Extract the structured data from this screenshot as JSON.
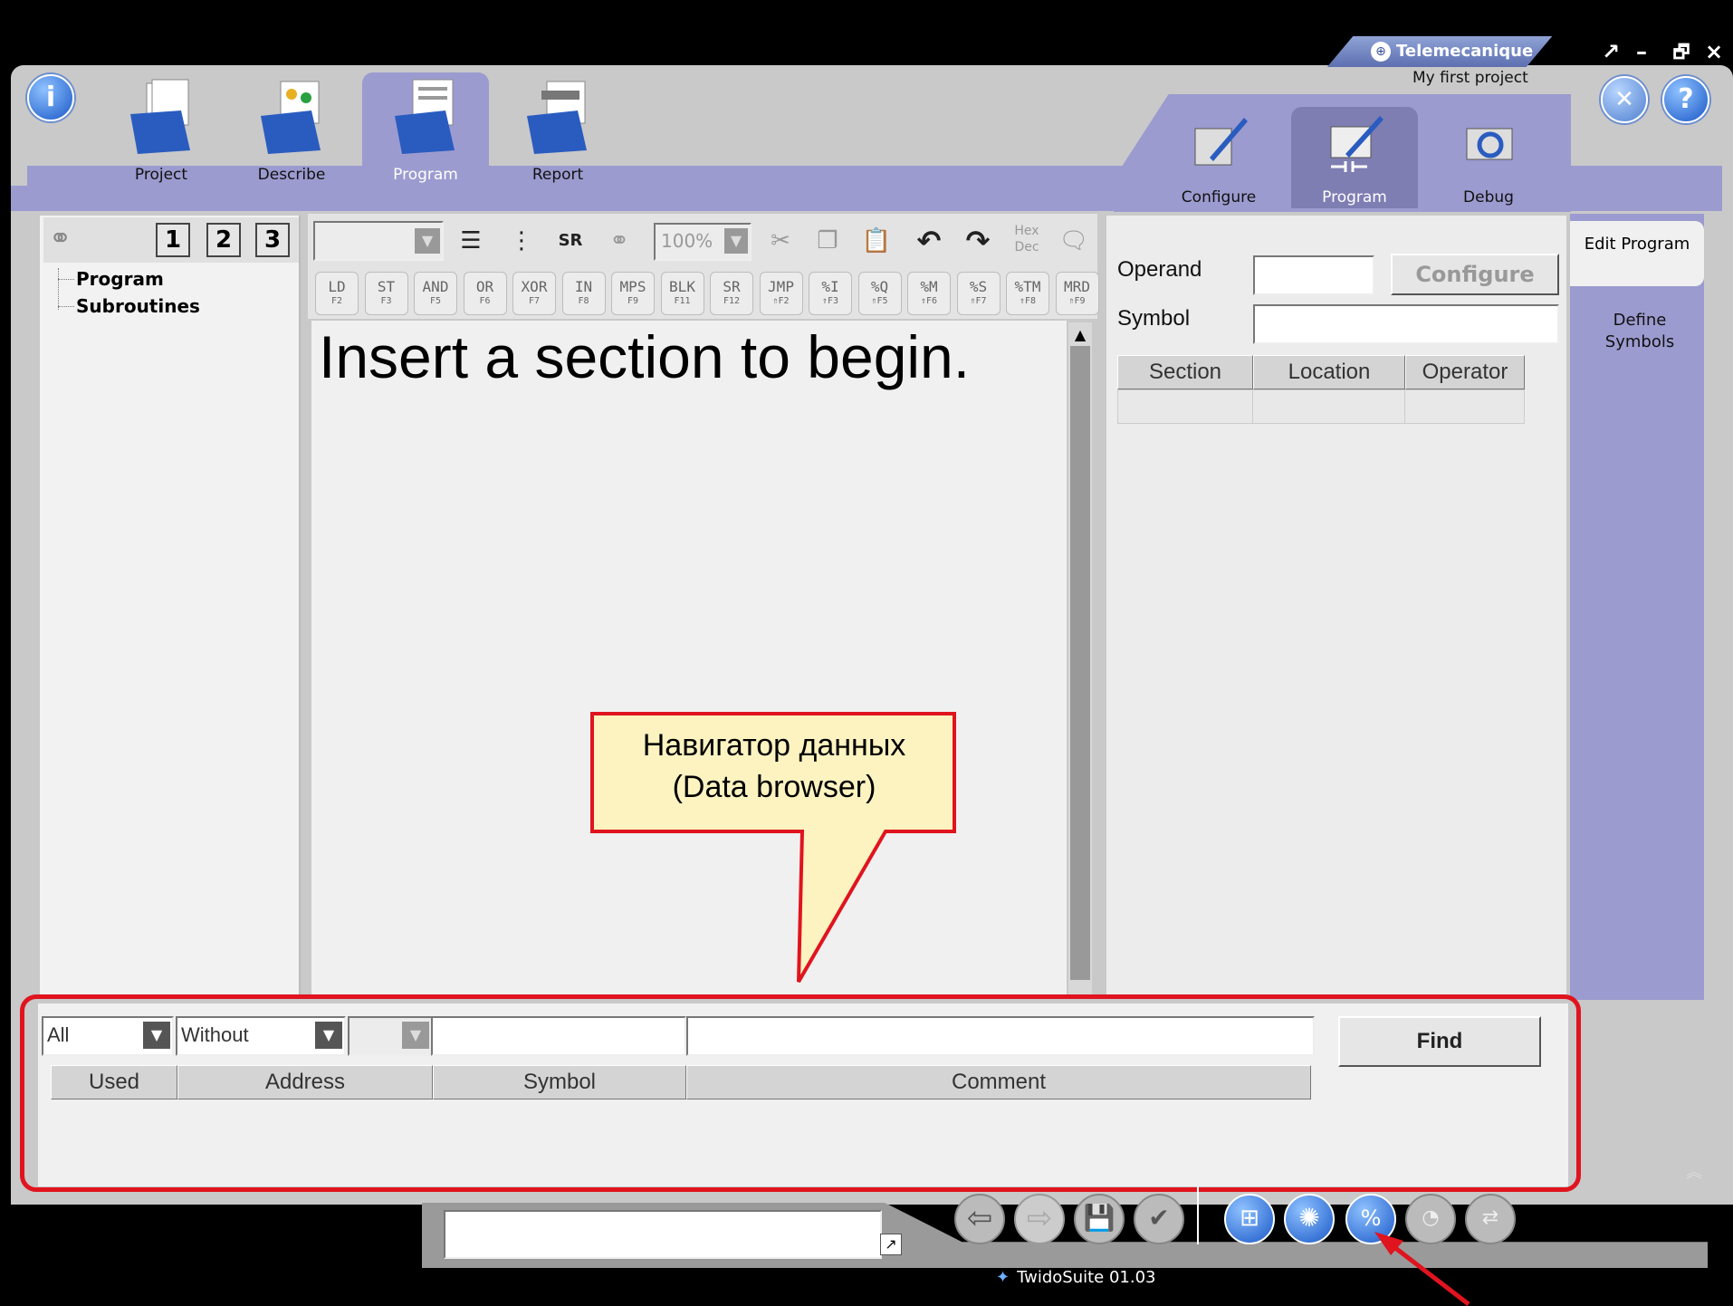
{
  "brand": "Telemecanique",
  "project_name": "My first project",
  "window_controls": [
    "↗",
    "–",
    "🗗",
    "×"
  ],
  "main_tabs": [
    {
      "label": "Project",
      "icon": "project-folder-icon"
    },
    {
      "label": "Describe",
      "icon": "describe-folder-icon"
    },
    {
      "label": "Program",
      "icon": "program-folder-icon",
      "active": true
    },
    {
      "label": "Report",
      "icon": "report-folder-icon"
    }
  ],
  "sub_tabs": [
    {
      "label": "Configure",
      "icon": "configure-icon"
    },
    {
      "label": "Program",
      "icon": "program-pencil-icon",
      "active": true
    },
    {
      "label": "Debug",
      "icon": "debug-icon"
    }
  ],
  "right_tasks": [
    {
      "label": "Edit Program",
      "active": true
    },
    {
      "label": "Define Symbols"
    }
  ],
  "left_tree": {
    "view_buttons": [
      "1",
      "2",
      "3"
    ],
    "items": [
      "Program",
      "Subroutines"
    ]
  },
  "editor_toolbar": {
    "zoom": "100%",
    "hex": "Hex",
    "dec": "Dec"
  },
  "instruction_buttons": [
    {
      "key": "LD",
      "fn": "F2"
    },
    {
      "key": "ST",
      "fn": "F3"
    },
    {
      "key": "AND",
      "fn": "F5"
    },
    {
      "key": "OR",
      "fn": "F6"
    },
    {
      "key": "XOR",
      "fn": "F7"
    },
    {
      "key": "IN",
      "fn": "F8"
    },
    {
      "key": "MPS",
      "fn": "F9"
    },
    {
      "key": "BLK",
      "fn": "F11"
    },
    {
      "key": "SR",
      "fn": "F12"
    },
    {
      "key": "JMP",
      "fn": "⇑F2"
    },
    {
      "key": "%I",
      "fn": "⇑F3"
    },
    {
      "key": "%Q",
      "fn": "⇑F5"
    },
    {
      "key": "%M",
      "fn": "⇑F6"
    },
    {
      "key": "%S",
      "fn": "⇑F7"
    },
    {
      "key": "%TM",
      "fn": "⇑F8"
    },
    {
      "key": "MRD",
      "fn": "⇑F9"
    }
  ],
  "editor_message": "Insert a section to begin.",
  "callout": {
    "line1": "Навигатор данных",
    "line2": "(Data browser)"
  },
  "operand_panel": {
    "operand_label": "Operand",
    "symbol_label": "Symbol",
    "configure_button": "Configure",
    "columns": [
      "Section",
      "Location",
      "Operator"
    ]
  },
  "data_browser": {
    "filter1": "All",
    "filter2": "Without",
    "find_button": "Find",
    "columns": [
      "Used",
      "Address",
      "Symbol",
      "Comment"
    ]
  },
  "status_bar": "TwidoSuite 01.03",
  "colors": {
    "tab_purple": "#9c9bd0",
    "highlight_red": "#e0141e",
    "callout_fill": "#fdf3c0"
  }
}
